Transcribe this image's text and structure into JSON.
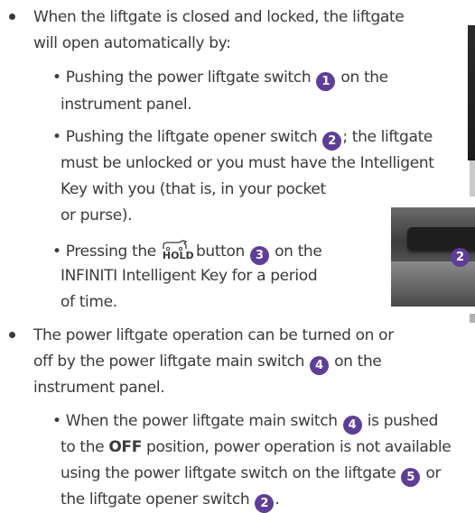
{
  "colors": {
    "badge": "#5e3e96",
    "text": "#3a3a3a"
  },
  "items": [
    {
      "lines": [
        "When the liftgate is closed and locked, the liftgate",
        "will open automatically by:"
      ],
      "subitems": [
        {
          "l1_pre": "Pushing the power liftgate switch ",
          "l1_num": "1",
          "l1_post": " on the",
          "l2": "instrument panel."
        },
        {
          "l1_pre": "Pushing the liftgate opener switch ",
          "l1_num": "2",
          "l1_post": "; the liftgate",
          "l2": "must be unlocked or you must have the Intelligent",
          "l3": "Key with you (that is, in your pocket",
          "l4": "or purse)."
        },
        {
          "l1_pre": "Pressing the ",
          "icon": "HOLD",
          "l1_mid": " button ",
          "l1_num": "3",
          "l1_post": " on the",
          "l2": "INFINITI Intelligent Key for a period",
          "l3": "of time."
        }
      ]
    },
    {
      "l1": "The power liftgate operation can be turned on or",
      "l2_pre": "off by the power liftgate main switch ",
      "l2_num": "4",
      "l2_post": " on the",
      "l3": "instrument panel.",
      "subitems": [
        {
          "l1_pre": "When the power liftgate main switch ",
          "l1_num": "4",
          "l1_post": " is pushed",
          "l2_pre": "to the ",
          "l2_bold": "OFF",
          "l2_post": " position, power operation is not available",
          "l3_pre": "using the power liftgate switch on the liftgate ",
          "l3_num": "5",
          "l3_post": " or",
          "l4_pre": "the liftgate opener switch ",
          "l4_num": "2",
          "l4_post": "."
        }
      ]
    }
  ],
  "photo": {
    "label": "2"
  }
}
